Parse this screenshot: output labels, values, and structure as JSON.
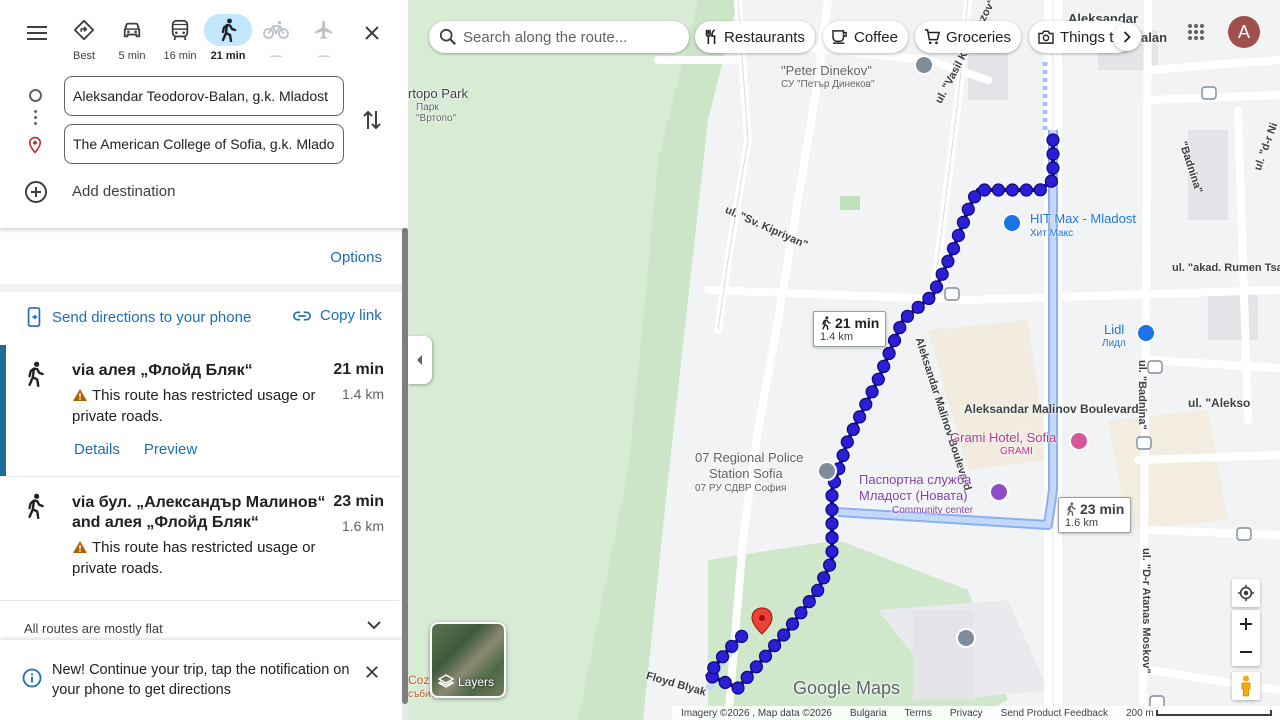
{
  "panel": {
    "modes": [
      {
        "label": "Best",
        "icon": "diamond-route-icon",
        "state": "normal"
      },
      {
        "label": "5 min",
        "icon": "car-icon",
        "state": "normal"
      },
      {
        "label": "16 min",
        "icon": "transit-icon",
        "state": "normal"
      },
      {
        "label": "21 min",
        "icon": "walk-icon",
        "state": "active"
      },
      {
        "label": "—",
        "icon": "bike-icon",
        "state": "disabled"
      },
      {
        "label": "—",
        "icon": "flight-icon",
        "state": "disabled"
      }
    ],
    "origin": "Aleksandar Teodorov-Balan, g.k. Mladost",
    "destination": "The American College of Sofia, g.k. Mladost",
    "add_destination": "Add destination",
    "options": "Options",
    "send_to_phone": "Send directions to your phone",
    "copy_link": "Copy link",
    "routes": [
      {
        "via": "via алея „Флойд Бляк“",
        "duration": "21 min",
        "distance": "1.4 km",
        "warning": "This route has restricted usage or private roads.",
        "details": "Details",
        "preview": "Preview"
      },
      {
        "via": "via бул. „Александър Малинов“ and алея „Флойд Бляк“",
        "duration": "23 min",
        "distance": "1.6 km",
        "warning": "This route has restricted usage or private roads."
      }
    ],
    "elevation_summary": "All routes are mostly flat",
    "notice": "New! Continue your trip, tap the notification on your phone to get directions"
  },
  "map": {
    "search_placeholder": "Search along the route...",
    "chips": [
      "Restaurants",
      "Coffee",
      "Groceries",
      "Things t"
    ],
    "avatar_letter": "A",
    "labels": {
      "park_en": "rtopo Park",
      "park_bg1": "Парк",
      "park_bg2": "\"Вртопо\"",
      "school_en": "\"Peter Dinekov\"",
      "school_bg": "СУ \"Петър Динеков\"",
      "top_street": "Aleksandar",
      "balan": "alan",
      "vasil": "ul. \"Vasil Karagyozov\"",
      "kipriyan": "ul. \"Sv. Kipriyan\"",
      "badnina_top": "\"Badnina\"",
      "d_r_ni": "ul. \"d-r Ni",
      "rumen": "ul. \"akad. Rumen Tsa",
      "lidl_en": "Lidl",
      "lidl_bg": "Лидл",
      "hit_en": "HIT Max - Mladost",
      "hit_bg": "Хит Макс",
      "malinov_rot": "Aleksandar Malinov Boulevard",
      "malinov": "Aleksandar Malinov Boulevard",
      "badnina_mid": "ul. \"Badnina\"",
      "alekso_right": "ul. \"Alekso",
      "grami_en": "Grami Hotel, Sofia",
      "grami_bg": "GRAMI",
      "police_1": "07 Regional Police",
      "police_2": "Station Sofia",
      "police_bg": "07 РУ СДВР София",
      "passport_1": "Паспортна служба",
      "passport_2": "Младост (Новата)",
      "community": "Community center",
      "moskov": "ul. \"D-r Atanas Moskov\"",
      "floyd": "Floyd Blyak",
      "coz": "Coz",
      "events": "събития"
    },
    "route_tips": [
      {
        "duration": "21 min",
        "distance": "1.4 km"
      },
      {
        "duration": "23 min",
        "distance": "1.6 km"
      }
    ],
    "layers_label": "Layers",
    "logo": "Google Maps",
    "footer": {
      "imagery": "Imagery ©2026 , Map data ©2026",
      "country": "Bulgaria",
      "terms": "Terms",
      "privacy": "Privacy",
      "feedback": "Send Product Feedback",
      "scale": "200 m"
    },
    "colors": {
      "route_primary": "#2b1fd6",
      "route_alt": "#a8c4f5",
      "accent_link": "#1a6dbd",
      "active_mode_bg": "#c2e7ff"
    }
  }
}
